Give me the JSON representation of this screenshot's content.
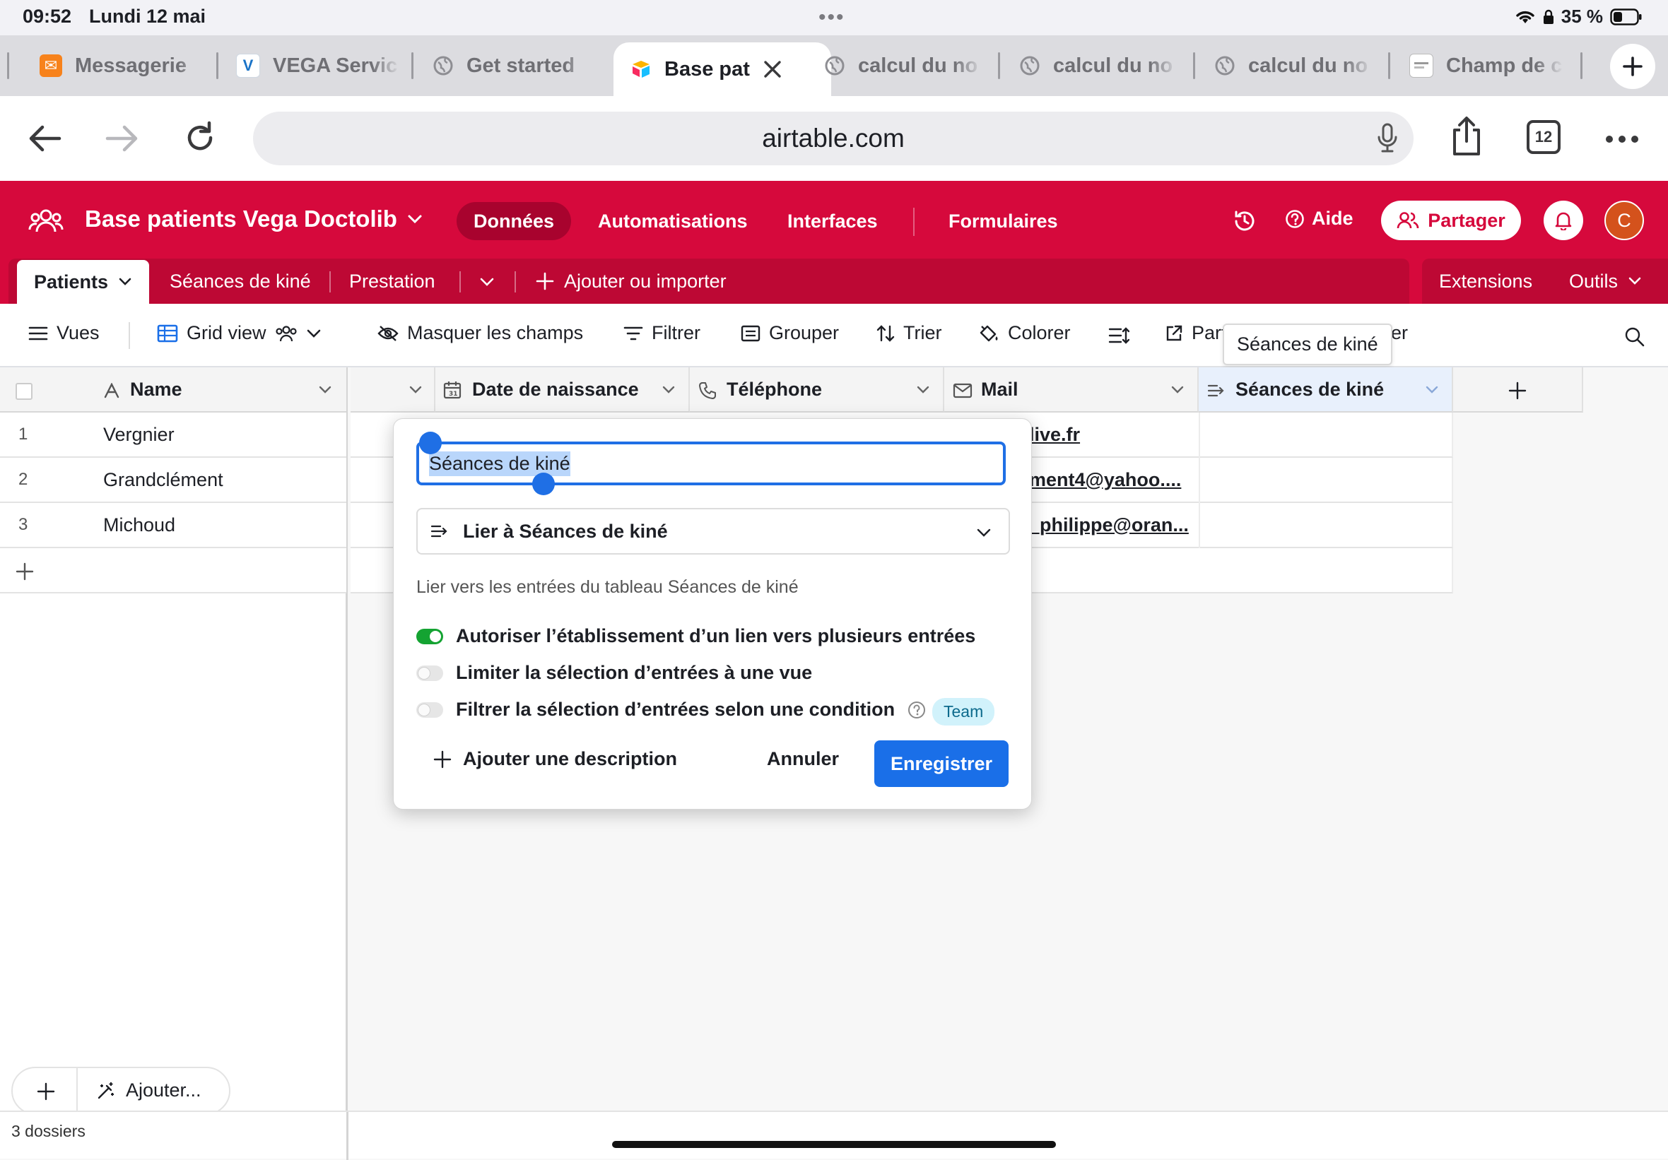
{
  "status_bar": {
    "time": "09:52",
    "date": "Lundi 12 mai",
    "battery": "35 %"
  },
  "browser_tabs": [
    {
      "label": "Messagerie",
      "favicon": "mail-icon",
      "color": "#f7821b"
    },
    {
      "label": "VEGA Servic",
      "favicon": "vega-icon",
      "color": "#1a73c7"
    },
    {
      "label": "Get started",
      "favicon": "globe-icon",
      "color": "#8e8e93"
    },
    {
      "label": "Base pat",
      "favicon": "airtable-icon",
      "active": true
    },
    {
      "label": "calcul du no",
      "favicon": "globe-icon"
    },
    {
      "label": "calcul du no",
      "favicon": "globe-icon"
    },
    {
      "label": "calcul du no",
      "favicon": "globe-icon"
    },
    {
      "label": "Champ de c",
      "favicon": "doc-icon"
    }
  ],
  "toolbar": {
    "url": "airtable.com",
    "tab_count": "12"
  },
  "airtable": {
    "accent": "#d6093c",
    "base_title": "Base patients Vega Doctolib",
    "nav": [
      "Données",
      "Automatisations",
      "Interfaces",
      "Formulaires"
    ],
    "help_label": "Aide",
    "share_label": "Partager",
    "avatar_letter": "C",
    "tables": [
      "Patients",
      "Séances de kiné",
      "Prestation"
    ],
    "add_import_label": "Ajouter ou importer",
    "extensions_label": "Extensions",
    "tools_label": "Outils"
  },
  "viewbar": {
    "views_label": "Vues",
    "grid_view_label": "Grid view",
    "hide_fields": "Masquer les champs",
    "filter": "Filtrer",
    "group": "Grouper",
    "sort": "Trier",
    "color": "Colorer",
    "share_partial": "Part",
    "share_tail": "er",
    "tooltip": "Séances de kiné"
  },
  "grid": {
    "columns": [
      "Name",
      "",
      "Date de naissance",
      "Téléphone",
      "Mail",
      "Séances de kiné"
    ],
    "rows": [
      {
        "num": "1",
        "name": "Vergnier",
        "mail": "live.fr"
      },
      {
        "num": "2",
        "name": "Grandclément",
        "mail": "ment4@yahoo...."
      },
      {
        "num": "3",
        "name": "Michoud",
        "mail": "_philippe@oran..."
      }
    ],
    "add_label": "Ajouter...",
    "record_count": "3 dossiers"
  },
  "popup": {
    "field_name": "Séances de kiné",
    "field_type": "Lier à Séances de kiné",
    "description": "Lier vers les entrées du tableau Séances de kiné",
    "options": [
      {
        "label": "Autoriser l’établissement d’un lien vers plusieurs entrées",
        "on": true
      },
      {
        "label": "Limiter la sélection d’entrées à une vue",
        "on": false
      },
      {
        "label": "Filtrer la sélection d’entrées selon une condition",
        "on": false
      }
    ],
    "team_badge": "Team",
    "add_description": "Ajouter une description",
    "cancel": "Annuler",
    "save": "Enregistrer"
  }
}
